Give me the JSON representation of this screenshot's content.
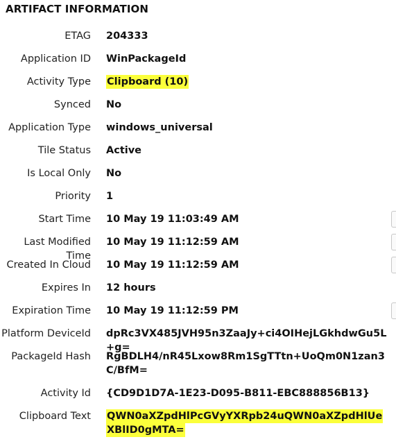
{
  "section_title": "ARTIFACT INFORMATION",
  "fields": [
    {
      "label": "ETAG",
      "value": "204333"
    },
    {
      "label": "Application ID",
      "value": "WinPackageId"
    },
    {
      "label": "Activity Type",
      "value": "Clipboard (10)"
    },
    {
      "label": "Synced",
      "value": "No"
    },
    {
      "label": "Application Type",
      "value": "windows_universal"
    },
    {
      "label": "Tile Status",
      "value": "Active"
    },
    {
      "label": "Is Local Only",
      "value": "No"
    },
    {
      "label": "Priority",
      "value": "1"
    },
    {
      "label": "Start Time",
      "value": "10 May 19 11:03:49 AM"
    },
    {
      "label": "Last Modified Time",
      "value": "10 May 19 11:12:59 AM"
    },
    {
      "label": "Created In Cloud",
      "value": "10 May 19 11:12:59 AM"
    },
    {
      "label": "Expires In",
      "value": "12 hours"
    },
    {
      "label": "Expiration Time",
      "value": "10 May 19 11:12:59 PM"
    },
    {
      "label": "Platform DeviceId",
      "value": "dpRc3VX485JVH95n3ZaaJy+ci4OIHejLGkhdwGu5L+g="
    },
    {
      "label": "PackageId Hash",
      "value": "RgBDLH4/nR45Lxow8Rm1SgTTtn+UoQm0N1zan3C/BfM="
    },
    {
      "label": "Activity Id",
      "value": "{CD9D1D7A-1E23-D095-B811-EBC888856B13}"
    },
    {
      "label": "Clipboard Text",
      "value": "QWN0aXZpdHlPcGVyYXRpb24uQWN0aXZpdHlUeXBlID0gMTA="
    }
  ],
  "highlight_color": "#fbff3b"
}
